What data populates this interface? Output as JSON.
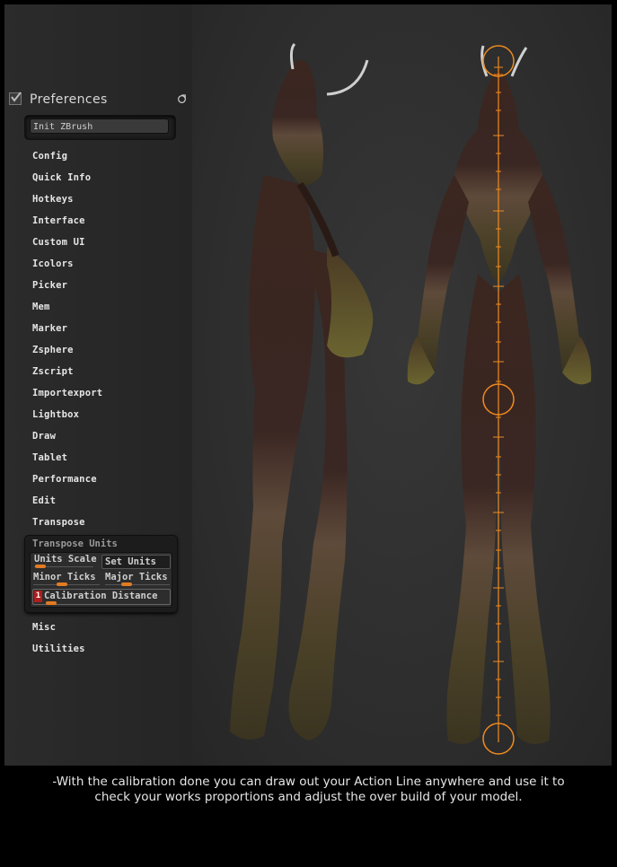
{
  "preferences": {
    "title": "Preferences",
    "init_button": "Init ZBrush",
    "menu_top": [
      "Config",
      "Quick Info",
      "Hotkeys",
      "Interface",
      "Custom UI",
      "Icolors",
      "Picker",
      "Mem",
      "Marker",
      "Zsphere",
      "Zscript",
      "Importexport",
      "Lightbox",
      "Draw",
      "Tablet",
      "Performance",
      "Edit",
      "Transpose"
    ],
    "transpose_units": {
      "title": "Transpose Units",
      "units_scale": "Units Scale",
      "set_units": "Set Units",
      "minor_ticks": "Minor Ticks",
      "major_ticks": "Major Ticks",
      "calibration_number": "1",
      "calibration_distance": "Calibration Distance"
    },
    "menu_bottom": [
      "Misc",
      "Utilities"
    ]
  },
  "colors": {
    "accent": "#e27b22",
    "action_line": "#f08a1e",
    "badge": "#b01d1d"
  },
  "caption": {
    "line1": "-With the calibration done you can draw out your Action Line anywhere and use it to",
    "line2": "check your works proportions and adjust the over build of your model."
  }
}
